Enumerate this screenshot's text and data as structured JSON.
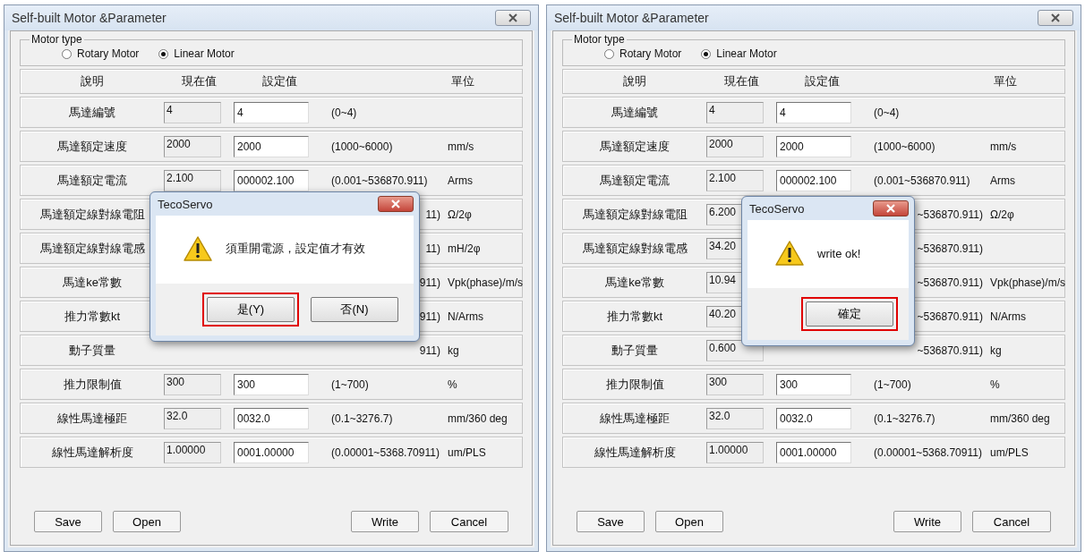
{
  "windows": [
    {
      "title": "Self-built Motor &Parameter",
      "motor_type": {
        "label": "Motor type",
        "options": [
          {
            "label": "Rotary Motor",
            "selected": false
          },
          {
            "label": "Linear Motor",
            "selected": true
          }
        ]
      },
      "headers": [
        "說明",
        "現在值",
        "設定值",
        "單位"
      ],
      "rows": [
        {
          "label": "馬達編號",
          "current": "4",
          "set": "4",
          "range": "(0~4)"
        },
        {
          "label": "馬達額定速度",
          "current": "2000",
          "set": "2000",
          "range": "(1000~6000)",
          "unit": "mm/s"
        },
        {
          "label": "馬達額定電流",
          "current": "2.100",
          "set": "000002.100",
          "range": "(0.001~536870.911)",
          "unit": "Arms"
        },
        {
          "label": "馬達額定線對線電阻",
          "range": "11)",
          "unit": "Ω/2φ"
        },
        {
          "label": "馬達額定線對線電感",
          "range": "11)",
          "unit": "mH/2φ"
        },
        {
          "label": "馬達ke常數",
          "range": "911)",
          "unit": "Vpk(phase)/m/s"
        },
        {
          "label": "推力常數kt",
          "range": "911)",
          "unit": "N/Arms"
        },
        {
          "label": "動子質量",
          "range": "911)",
          "unit": "kg"
        },
        {
          "label": "推力限制值",
          "current": "300",
          "set": "300",
          "range": "(1~700)",
          "unit": "%"
        },
        {
          "label": "線性馬達極距",
          "current": "32.0",
          "set": "0032.0",
          "range": "(0.1~3276.7)",
          "unit": "mm/360 deg"
        },
        {
          "label": "線性馬達解析度",
          "current": "1.00000",
          "set": "0001.00000",
          "range": "(0.00001~5368.70911)",
          "unit": "um/PLS"
        }
      ],
      "buttons": [
        "Save",
        "Open",
        "Write",
        "Cancel"
      ],
      "dialog": {
        "title": "TecoServo",
        "message": "須重開電源，設定值才有效",
        "buttons": [
          {
            "label": "是(Y)",
            "highlighted": true
          },
          {
            "label": "否(N)",
            "highlighted": false
          }
        ]
      }
    },
    {
      "title": "Self-built Motor &Parameter",
      "motor_type": {
        "label": "Motor type",
        "options": [
          {
            "label": "Rotary Motor",
            "selected": false
          },
          {
            "label": "Linear Motor",
            "selected": true
          }
        ]
      },
      "headers": [
        "說明",
        "現在值",
        "設定值",
        "單位"
      ],
      "rows": [
        {
          "label": "馬達編號",
          "current": "4",
          "set": "4",
          "range": "(0~4)"
        },
        {
          "label": "馬達額定速度",
          "current": "2000",
          "set": "2000",
          "range": "(1000~6000)",
          "unit": "mm/s"
        },
        {
          "label": "馬達額定電流",
          "current": "2.100",
          "set": "000002.100",
          "range": "(0.001~536870.911)",
          "unit": "Arms"
        },
        {
          "label": "馬達額定線對線電阻",
          "current": "6.200",
          "range": "~536870.911)",
          "unit": "Ω/2φ"
        },
        {
          "label": "馬達額定線對線電感",
          "current": "34.20",
          "range": "~536870.911)"
        },
        {
          "label": "馬達ke常數",
          "current": "10.94",
          "range": "~536870.911)",
          "unit": "Vpk(phase)/m/s"
        },
        {
          "label": "推力常數kt",
          "current": "40.20",
          "range": "~536870.911)",
          "unit": "N/Arms"
        },
        {
          "label": "動子質量",
          "current": "0.600",
          "range": "~536870.911)",
          "unit": "kg"
        },
        {
          "label": "推力限制值",
          "current": "300",
          "set": "300",
          "range": "(1~700)",
          "unit": "%"
        },
        {
          "label": "線性馬達極距",
          "current": "32.0",
          "set": "0032.0",
          "range": "(0.1~3276.7)",
          "unit": "mm/360 deg"
        },
        {
          "label": "線性馬達解析度",
          "current": "1.00000",
          "set": "0001.00000",
          "range": "(0.00001~5368.70911)",
          "unit": "um/PLS"
        }
      ],
      "buttons": [
        "Save",
        "Open",
        "Write",
        "Cancel"
      ],
      "dialog": {
        "title": "TecoServo",
        "message": "write ok!",
        "buttons": [
          {
            "label": "確定",
            "highlighted": true
          }
        ]
      }
    }
  ]
}
